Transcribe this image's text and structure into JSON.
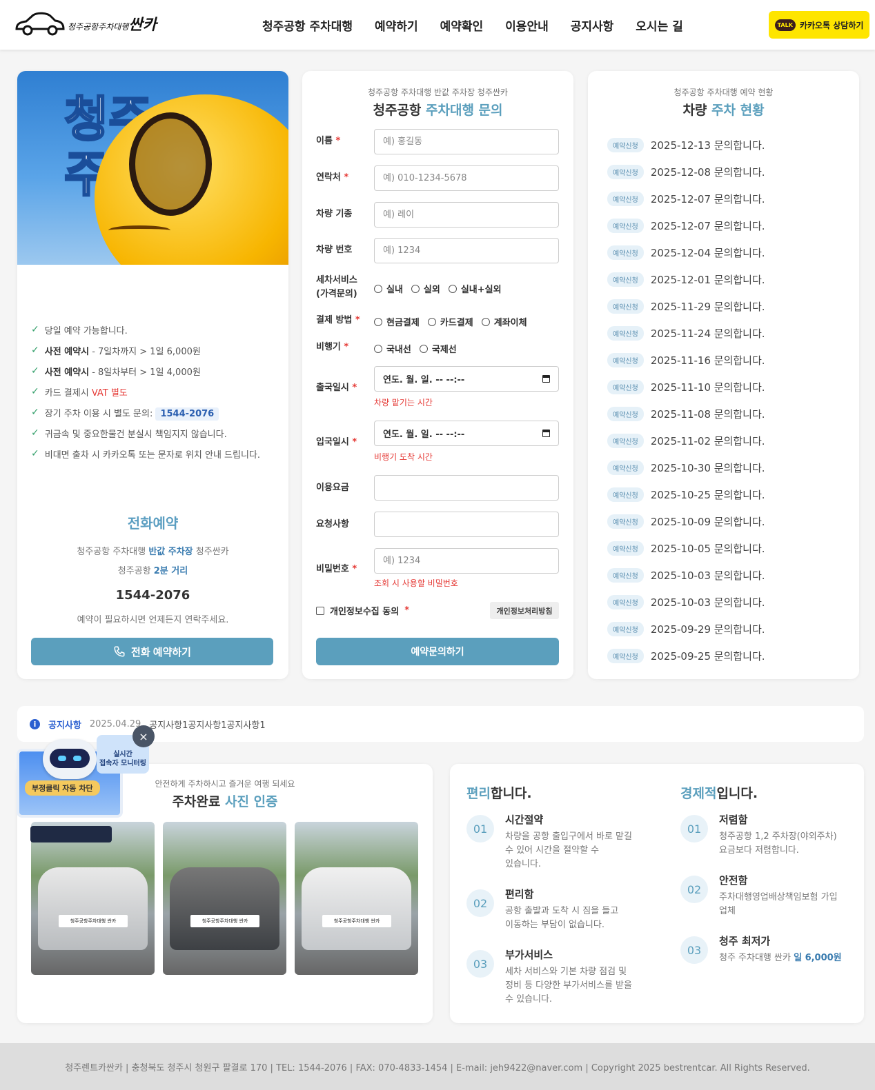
{
  "header": {
    "logo_small": "청주공항주차대행",
    "logo_big": "싼카",
    "nav": [
      "청주공항 주차대행",
      "예약하기",
      "예약확인",
      "이용안내",
      "공지사항",
      "오시는 길"
    ],
    "kakao_badge": "TALK",
    "kakao_label": "카카오톡 상담하기"
  },
  "hero": {
    "text_line1": "청주",
    "text_line2": "주"
  },
  "features": [
    {
      "plain": "당일 예약 가능합니다."
    },
    {
      "bold": "사전 예약시",
      "plain": " - 7일차까지 > 1일 6,000원"
    },
    {
      "bold": "사전 예약시",
      "plain": " - 8일차부터 > 1일 4,000원"
    },
    {
      "plain": "카드 결제시 ",
      "red": "VAT 별도"
    },
    {
      "plain": "장기 주차 이용 시 별도 문의: ",
      "tag": "1544-2076"
    },
    {
      "plain": "귀금속 및 중요한물건 분실시 책임지지 않습니다."
    },
    {
      "plain": "비대면 출차 시 카카오톡 또는 문자로 위치 안내 드립니다."
    }
  ],
  "phone_section": {
    "title": "전화예약",
    "line1_a": "청주공항 주차대행 ",
    "line1_b": "반값 주차장",
    "line1_c": " 청주싼카",
    "line2_a": "청주공항 ",
    "line2_b": "2분 거리",
    "number": "1544-2076",
    "note": "예약이 필요하시면 언제든지 연락주세요.",
    "button": "전화 예약하기"
  },
  "form": {
    "sub": "청주공항 주차대행 반값 주차장 청주싼카",
    "title_a": "청주공항 ",
    "title_b": "주차대행 문의",
    "name_label": "이름",
    "name_ph": "예) 홍길동",
    "phone_label": "연락처",
    "phone_ph": "예) 010-1234-5678",
    "car_label": "차량 기종",
    "car_ph": "예) 레이",
    "carno_label": "차량 번호",
    "carno_ph": "예) 1234",
    "wash_label_1": "세차서비스",
    "wash_label_2": "(가격문의)",
    "wash_options": [
      "실내",
      "실외",
      "실내+실외"
    ],
    "pay_label": "결제 방법",
    "pay_options": [
      "현금결제",
      "카드결제",
      "계좌이체"
    ],
    "flight_label": "비행기",
    "flight_options": [
      "국내선",
      "국제선"
    ],
    "depart_label": "출국일시",
    "depart_value": "연도. 월. 일. -- --:--",
    "depart_hint": "차량 맡기는 시간",
    "arrive_label": "입국일시",
    "arrive_value": "연도. 월. 일. -- --:--",
    "arrive_hint": "비행기 도착 시간",
    "fee_label": "이용요금",
    "request_label": "요청사항",
    "pw_label": "비밀번호",
    "pw_ph": "예) 1234",
    "pw_hint": "조회 시 사용할 비밀번호",
    "agree_label": "개인정보수집 동의",
    "privacy_btn": "개인정보처리방침",
    "submit": "예약문의하기",
    "req_mark": "*"
  },
  "status": {
    "sub": "청주공항 주차대행 예약 현황",
    "title_a": "차량 ",
    "title_b": "주차 현황",
    "badge": "예약신청",
    "items": [
      "2025-12-13 문의합니다.",
      "2025-12-08 문의합니다.",
      "2025-12-07 문의합니다.",
      "2025-12-07 문의합니다.",
      "2025-12-04 문의합니다.",
      "2025-12-01 문의합니다.",
      "2025-11-29 문의합니다.",
      "2025-11-24 문의합니다.",
      "2025-11-16 문의합니다.",
      "2025-11-10 문의합니다.",
      "2025-11-08 문의합니다.",
      "2025-11-02 문의합니다.",
      "2025-10-30 문의합니다.",
      "2025-10-25 문의합니다.",
      "2025-10-09 문의합니다.",
      "2025-10-05 문의합니다.",
      "2025-10-03 문의합니다.",
      "2025-10-03 문의합니다.",
      "2025-09-29 문의합니다.",
      "2025-09-25 문의합니다."
    ]
  },
  "notice": {
    "label": "공지사항",
    "date": "2025.04.29",
    "text": "공지사항1공지사항1공지사항1"
  },
  "robot": {
    "tag_line1": "실시간",
    "tag_line2": "접속자 모니터링",
    "block": "부정클릭 자동 차단",
    "close": "×"
  },
  "photos": {
    "sub": "안전하게 주차하시고 즐거운 여행 되세요",
    "title_a": "주차완료 ",
    "title_b": "사진 인증",
    "plate": "청주공항주차대행 싼카"
  },
  "benefits": {
    "left_title_a": "편리",
    "left_title_b": "합니다.",
    "left": [
      {
        "num": "01",
        "head": "시간절약",
        "desc": [
          "차량을 공항 출입구에서 바로 맡길",
          "수 있어 시간을 절약할 수",
          "있습니다."
        ]
      },
      {
        "num": "02",
        "head": "편리함",
        "desc": [
          "공항 출발과 도착 시 짐을 들고",
          "이동하는 부담이 없습니다."
        ]
      },
      {
        "num": "03",
        "head": "부가서비스",
        "desc": [
          "세차 서비스와 기본 차량 점검 및",
          "정비 등 다양한 부가서비스를 받을",
          "수 있습니다."
        ]
      }
    ],
    "right_title_a": "경제적",
    "right_title_b": "입니다.",
    "right": [
      {
        "num": "01",
        "head": "저렴함",
        "desc": [
          "청주공항 1,2 주차장(야외주차)",
          "요금보다 저렴합니다."
        ]
      },
      {
        "num": "02",
        "head": "안전함",
        "desc": [
          "주차대행영업배상책임보험 가입",
          "업체"
        ]
      },
      {
        "num": "03",
        "head": "청주 최저가",
        "desc_a": "청주 주차대행 싼카 ",
        "desc_b": "일 6,000원"
      }
    ]
  },
  "footer": {
    "text": "청주렌트카싼카 | 충청북도 청주시 청원구 팔결로 170 | TEL: 1544-2076 | FAX: 070-4833-1454 | E-mail: jeh9422@naver.com | Copyright 2025 bestrentcar. All Rights Reserved."
  },
  "colors": {
    "accent": "#5b9fbd",
    "kakao": "#fee500",
    "required": "#e53935"
  }
}
